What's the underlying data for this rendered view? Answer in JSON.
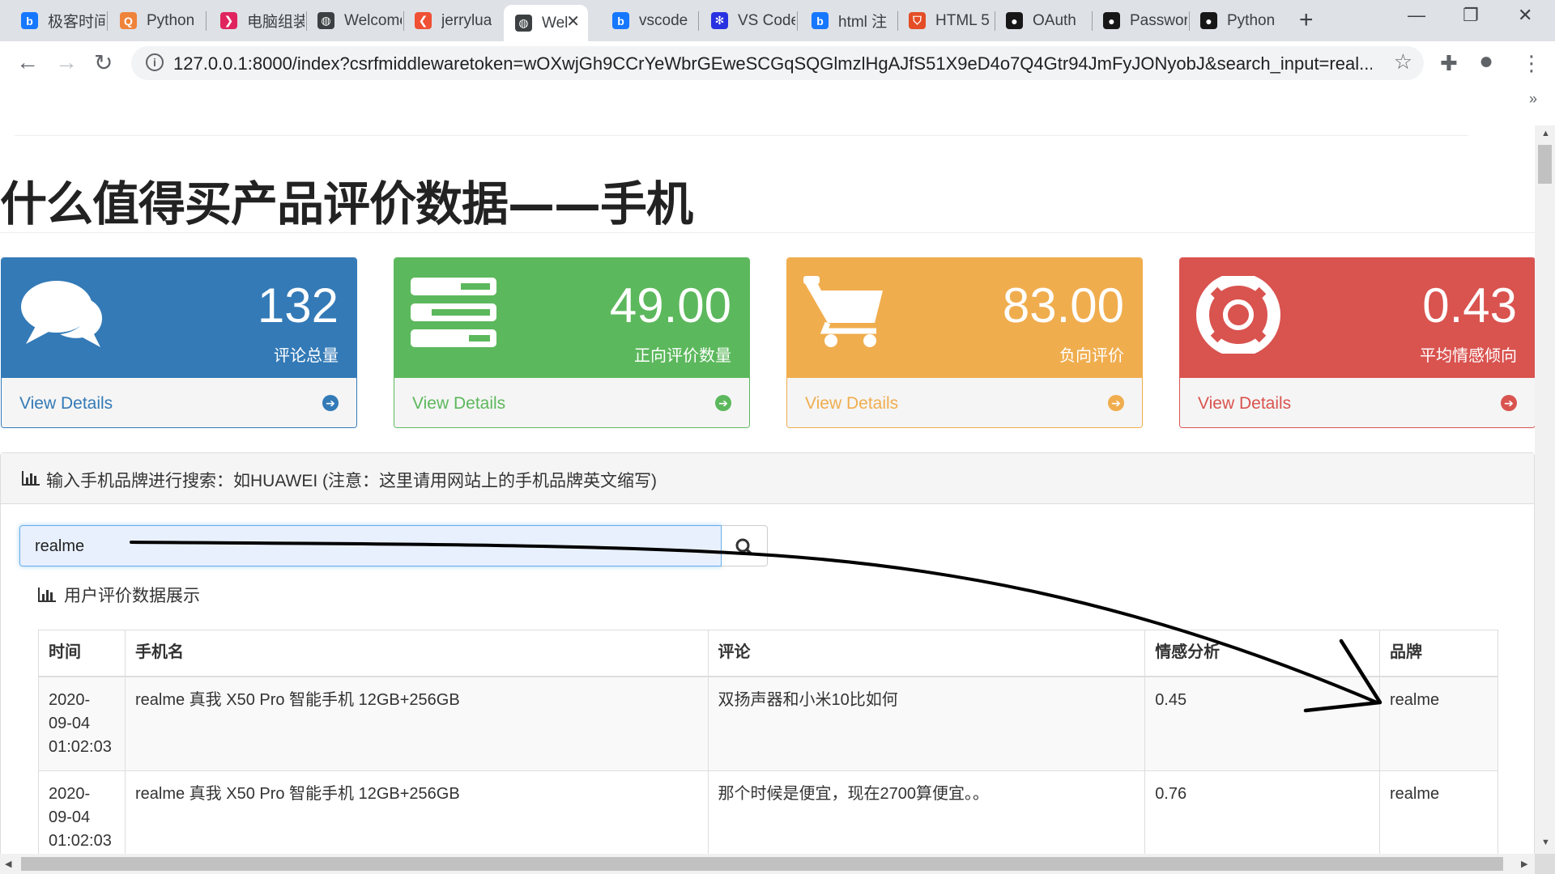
{
  "browser": {
    "tabs": [
      {
        "title": "极客时间",
        "color": "#1677ff",
        "glyph": "b"
      },
      {
        "title": "Python",
        "color": "#f0833a",
        "glyph": "Q"
      },
      {
        "title": "电脑组装",
        "color": "#e0245e",
        "glyph": "❯"
      },
      {
        "title": "Welcome",
        "color": "#3c4043",
        "glyph": "◍"
      },
      {
        "title": "jerrylua",
        "color": "#f05033",
        "glyph": "❮"
      },
      {
        "title": "Wel",
        "color": "#3c4043",
        "glyph": "◍"
      },
      {
        "title": "vscode",
        "color": "#1677ff",
        "glyph": "b"
      },
      {
        "title": "VS Code",
        "color": "#2932e1",
        "glyph": "✻"
      },
      {
        "title": "html 注",
        "color": "#1677ff",
        "glyph": "b"
      },
      {
        "title": "HTML 5",
        "color": "#e44d26",
        "glyph": "⛉"
      },
      {
        "title": "OAuth",
        "color": "#181717",
        "glyph": "●"
      },
      {
        "title": "Password",
        "color": "#181717",
        "glyph": "●"
      },
      {
        "title": "Python",
        "color": "#181717",
        "glyph": "●"
      }
    ],
    "url": "127.0.0.1:8000/index?csrfmiddlewaretoken=wOXwjGh9CCrYeWbrGEweSCGqSQGlmzlHgAJfS51X9eD4o7Q4Gtr94JmFyJONyobJ&search_input=real...",
    "info_glyph": "i",
    "star_glyph": "☆",
    "new_tab_glyph": "+",
    "close_glyph": "✕",
    "minimize_glyph": "—",
    "restore_glyph": "❐",
    "tab_close_glyph": "✕",
    "back_glyph": "←",
    "forward_glyph": "→",
    "reload_glyph": "↻",
    "menu_glyph": "⋮",
    "extension_glyph": "✚",
    "profile_glyph": "●",
    "bookmarks_more_glyph": "»"
  },
  "page": {
    "title": "什么值得买产品评价数据——手机",
    "panels": [
      {
        "value": "132",
        "label": "评论总量",
        "link": "View Details",
        "color": "#337ab7",
        "border": "#337ab7",
        "link_color": "#337ab7",
        "icon": "comments-icon"
      },
      {
        "value": "49.00",
        "label": "正向评价数量",
        "link": "View Details",
        "color": "#5cb85c",
        "border": "#5cb85c",
        "link_color": "#5cb85c",
        "icon": "tasks-icon"
      },
      {
        "value": "83.00",
        "label": "负向评价",
        "link": "View Details",
        "color": "#f0ad4e",
        "border": "#f0ad4e",
        "link_color": "#f0ad4e",
        "icon": "shopping-cart-icon"
      },
      {
        "value": "0.43",
        "label": "平均情感倾向",
        "link": "View Details",
        "color": "#d9534f",
        "border": "#d9534f",
        "link_color": "#d9534f",
        "icon": "support-icon"
      }
    ],
    "search": {
      "heading": "输入手机品牌进行搜索：如HUAWEI (注意：这里请用网站上的手机品牌英文缩写)",
      "value": "realme",
      "subheading": "用户评价数据展示"
    },
    "table": {
      "headers": [
        "时间",
        "手机名",
        "评论",
        "情感分析",
        "品牌"
      ],
      "rows": [
        {
          "time": "2020-09-04 01:02:03",
          "time_lines": [
            "2020-",
            "09-04",
            "01:02:03"
          ],
          "name": "realme 真我 X50 Pro 智能手机 12GB+256GB",
          "comment": "双扬声器和小米10比如何",
          "sentiment": "0.45",
          "brand": "realme"
        },
        {
          "time": "2020-09-04 01:02:03",
          "time_lines": [
            "2020-",
            "09-04",
            "01:02:03"
          ],
          "name": "realme 真我 X50 Pro 智能手机 12GB+256GB",
          "comment": "那个时候是便宜，现在2700算便宜。。",
          "sentiment": "0.76",
          "brand": "realme"
        }
      ]
    }
  }
}
